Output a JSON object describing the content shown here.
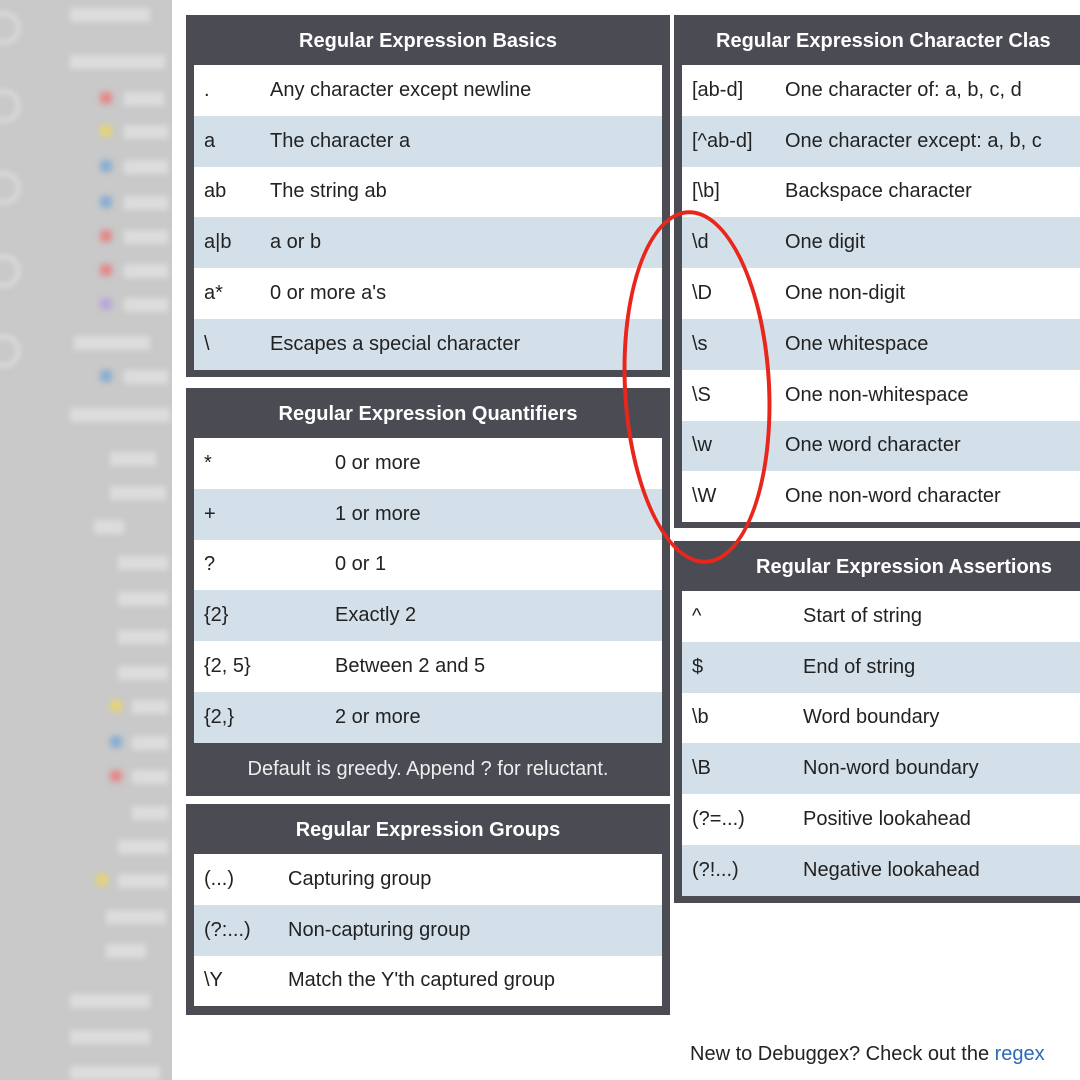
{
  "basics": {
    "title": "Regular Expression Basics",
    "rows": [
      {
        "sym": ".",
        "desc": "Any character except newline"
      },
      {
        "sym": "a",
        "desc": "The character a"
      },
      {
        "sym": "ab",
        "desc": "The string ab"
      },
      {
        "sym": "a|b",
        "desc": "a or b"
      },
      {
        "sym": "a*",
        "desc": "0 or more a's"
      },
      {
        "sym": "\\",
        "desc": "Escapes a special character"
      }
    ]
  },
  "quantifiers": {
    "title": "Regular Expression Quantifiers",
    "rows": [
      {
        "sym": "*",
        "desc": "0 or more"
      },
      {
        "sym": "+",
        "desc": "1 or more"
      },
      {
        "sym": "?",
        "desc": "0 or 1"
      },
      {
        "sym": "{2}",
        "desc": "Exactly 2"
      },
      {
        "sym": "{2, 5}",
        "desc": "Between 2 and 5"
      },
      {
        "sym": "{2,}",
        "desc": "2 or more"
      }
    ],
    "footer": "Default is greedy. Append ? for reluctant."
  },
  "groups": {
    "title": "Regular Expression Groups",
    "rows": [
      {
        "sym": "(...)",
        "desc": "Capturing group"
      },
      {
        "sym": "(?:...)",
        "desc": "Non-capturing group"
      },
      {
        "sym": "\\Y",
        "desc": "Match the Y'th captured group"
      }
    ]
  },
  "classes": {
    "title": "Regular Expression Character Clas",
    "rows": [
      {
        "sym": "[ab-d]",
        "desc": "One character of: a, b, c, d"
      },
      {
        "sym": "[^ab-d]",
        "desc": "One character except: a, b, c"
      },
      {
        "sym": "[\\b]",
        "desc": "Backspace character"
      },
      {
        "sym": "\\d",
        "desc": "One digit"
      },
      {
        "sym": "\\D",
        "desc": "One non-digit"
      },
      {
        "sym": "\\s",
        "desc": "One whitespace"
      },
      {
        "sym": "\\S",
        "desc": "One non-whitespace"
      },
      {
        "sym": "\\w",
        "desc": "One word character"
      },
      {
        "sym": "\\W",
        "desc": "One non-word character"
      }
    ]
  },
  "assertions": {
    "title": "Regular Expression Assertions",
    "rows": [
      {
        "sym": "^",
        "desc": "Start of string"
      },
      {
        "sym": "$",
        "desc": "End of string"
      },
      {
        "sym": "\\b",
        "desc": "Word boundary"
      },
      {
        "sym": "\\B",
        "desc": "Non-word boundary"
      },
      {
        "sym": "(?=...)",
        "desc": "Positive lookahead"
      },
      {
        "sym": "(?!...)",
        "desc": "Negative lookahead"
      }
    ]
  },
  "notice": {
    "text": "New to Debuggex? Check out the ",
    "link": "regex"
  },
  "colors": {
    "card_header": "#4b4b53",
    "row_alt": "#d3e0ea",
    "annotation": "#e8261c",
    "link": "#2a6ab8"
  }
}
